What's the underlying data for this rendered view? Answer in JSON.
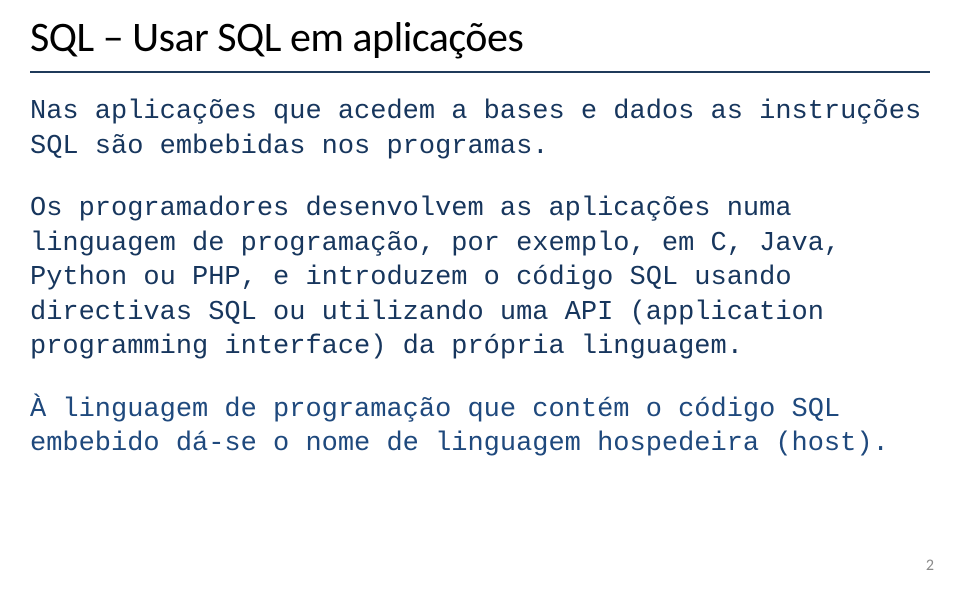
{
  "title": "SQL – Usar SQL em aplicações",
  "paragraphs": {
    "p1": "Nas aplicações que acedem a bases e dados as instruções SQL são embebidas nos programas.",
    "p2": "Os programadores desenvolvem as aplicações numa linguagem de programação, por exemplo, em C, Java, Python ou PHP, e introduzem o código SQL usando directivas SQL ou utilizando uma API (application programming interface) da própria linguagem.",
    "p3": "À linguagem de programação que contém o código SQL embebido dá-se o nome de linguagem hospedeira (host)."
  },
  "pageNumber": "2"
}
